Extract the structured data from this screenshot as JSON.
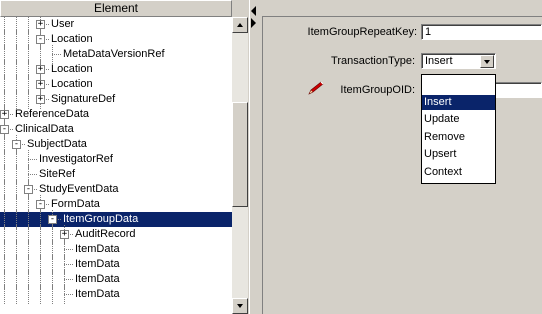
{
  "tree": {
    "header": "Element",
    "rows": [
      {
        "label": "User",
        "depth": 3,
        "expander": "+",
        "selected": false
      },
      {
        "label": "Location",
        "depth": 3,
        "expander": "-",
        "selected": false
      },
      {
        "label": "MetaDataVersionRef",
        "depth": 4,
        "expander": "",
        "selected": false
      },
      {
        "label": "Location",
        "depth": 3,
        "expander": "+",
        "selected": false
      },
      {
        "label": "Location",
        "depth": 3,
        "expander": "+",
        "selected": false
      },
      {
        "label": "SignatureDef",
        "depth": 3,
        "expander": "+",
        "selected": false
      },
      {
        "label": "ReferenceData",
        "depth": 0,
        "expander": "+",
        "selected": false
      },
      {
        "label": "ClinicalData",
        "depth": 0,
        "expander": "-",
        "selected": false
      },
      {
        "label": "SubjectData",
        "depth": 1,
        "expander": "-",
        "selected": false
      },
      {
        "label": "InvestigatorRef",
        "depth": 2,
        "expander": "",
        "selected": false
      },
      {
        "label": "SiteRef",
        "depth": 2,
        "expander": "",
        "selected": false
      },
      {
        "label": "StudyEventData",
        "depth": 2,
        "expander": "-",
        "selected": false
      },
      {
        "label": "FormData",
        "depth": 3,
        "expander": "-",
        "selected": false
      },
      {
        "label": "ItemGroupData",
        "depth": 4,
        "expander": "-",
        "selected": true
      },
      {
        "label": "AuditRecord",
        "depth": 5,
        "expander": "+",
        "selected": false
      },
      {
        "label": "ItemData",
        "depth": 5,
        "expander": "",
        "selected": false
      },
      {
        "label": "ItemData",
        "depth": 5,
        "expander": "",
        "selected": false
      },
      {
        "label": "ItemData",
        "depth": 5,
        "expander": "",
        "selected": false
      },
      {
        "label": "ItemData",
        "depth": 5,
        "expander": "",
        "selected": false
      }
    ]
  },
  "form": {
    "repeat_key_label": "ItemGroupRepeatKey:",
    "repeat_key_value": "1",
    "transaction_type_label": "TransactionType:",
    "transaction_type_value": "Insert",
    "item_group_oid_label": "ItemGroupOID:",
    "item_group_oid_value": ""
  },
  "dropdown": {
    "options": [
      "",
      "Insert",
      "Update",
      "Remove",
      "Upsert",
      "Context"
    ],
    "selected_index": 1
  },
  "icons": {
    "required_marker": "red-pen-icon"
  },
  "colors": {
    "selection": "#0a246a",
    "panel_bg": "#d4d0c8",
    "pen_red": "#cc0000"
  }
}
